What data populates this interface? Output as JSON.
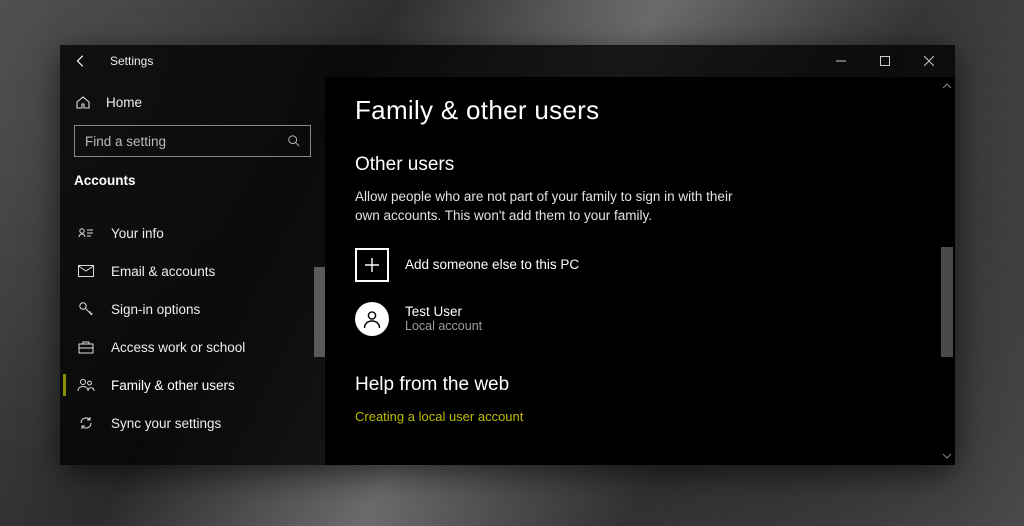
{
  "window": {
    "title": "Settings"
  },
  "sidebar": {
    "home": "Home",
    "search_placeholder": "Find a setting",
    "section": "Accounts",
    "items": [
      {
        "label": "Your info"
      },
      {
        "label": "Email & accounts"
      },
      {
        "label": "Sign-in options"
      },
      {
        "label": "Access work or school"
      },
      {
        "label": "Family & other users"
      },
      {
        "label": "Sync your settings"
      }
    ]
  },
  "main": {
    "title": "Family & other users",
    "other_users": {
      "heading": "Other users",
      "description": "Allow people who are not part of your family to sign in with their own accounts. This won't add them to your family.",
      "add_label": "Add someone else to this PC",
      "users": [
        {
          "name": "Test User",
          "type": "Local account"
        }
      ]
    },
    "help": {
      "heading": "Help from the web",
      "links": [
        "Creating a local user account"
      ]
    }
  }
}
